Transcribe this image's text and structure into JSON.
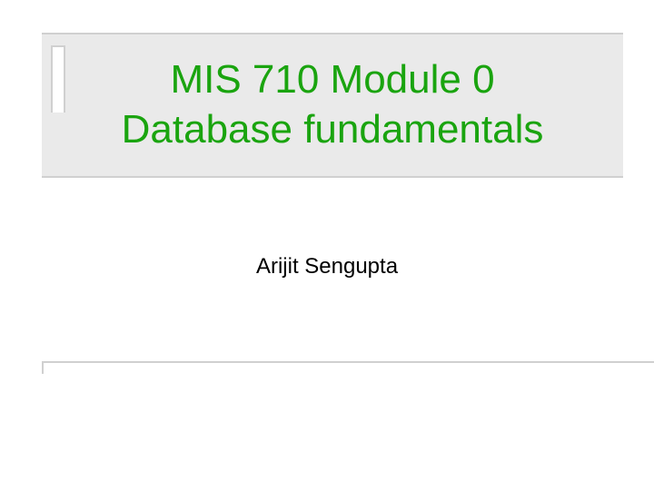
{
  "slide": {
    "title_line1": "MIS 710 Module 0",
    "title_line2": "Database fundamentals",
    "author": "Arijit Sengupta"
  },
  "colors": {
    "title": "#1aa40f",
    "banner_bg": "#eaeaea",
    "border": "#d0d0d0"
  }
}
